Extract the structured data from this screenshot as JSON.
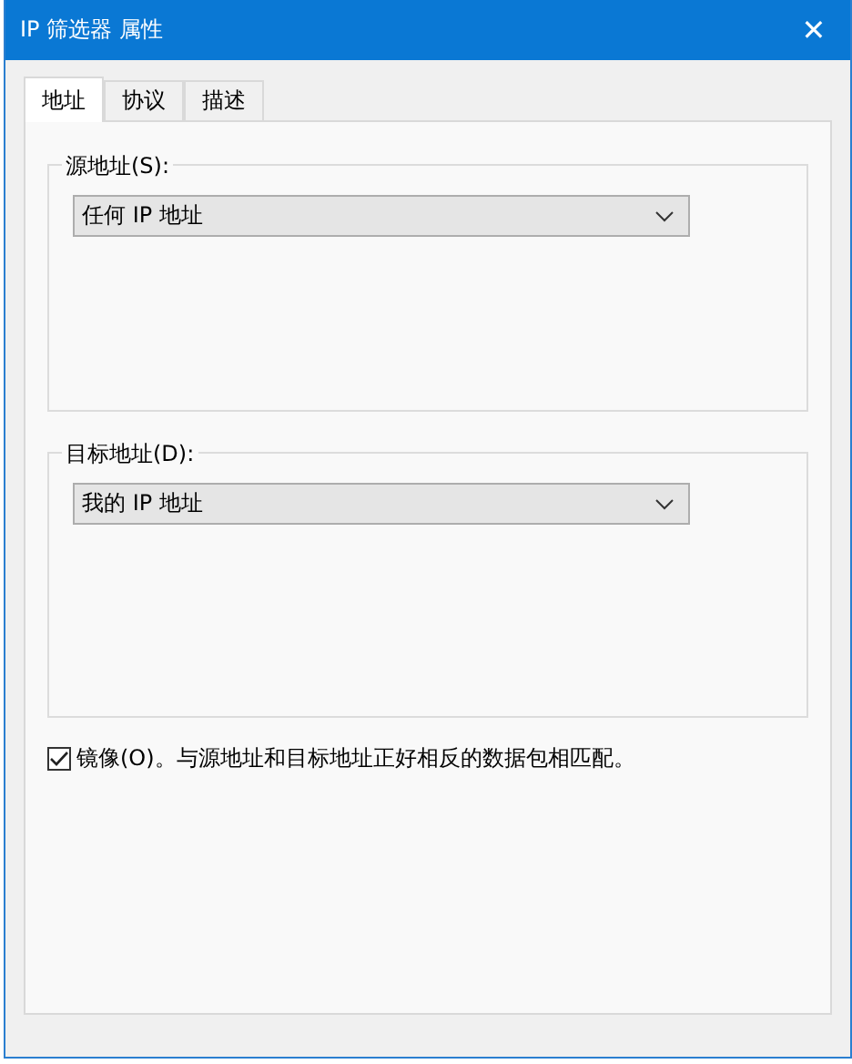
{
  "window": {
    "title": "IP 筛选器 属性",
    "close": "✕"
  },
  "tabs": [
    {
      "label": "地址",
      "selected": true
    },
    {
      "label": "协议",
      "selected": false
    },
    {
      "label": "描述",
      "selected": false
    }
  ],
  "groups": [
    {
      "label": "源地址(S):",
      "value": "任何 IP 地址"
    },
    {
      "label": "目标地址(D):",
      "value": "我的 IP 地址"
    }
  ],
  "mirror": {
    "label": "镜像(O)。与源地址和目标地址正好相反的数据包相匹配。",
    "checked": true
  }
}
